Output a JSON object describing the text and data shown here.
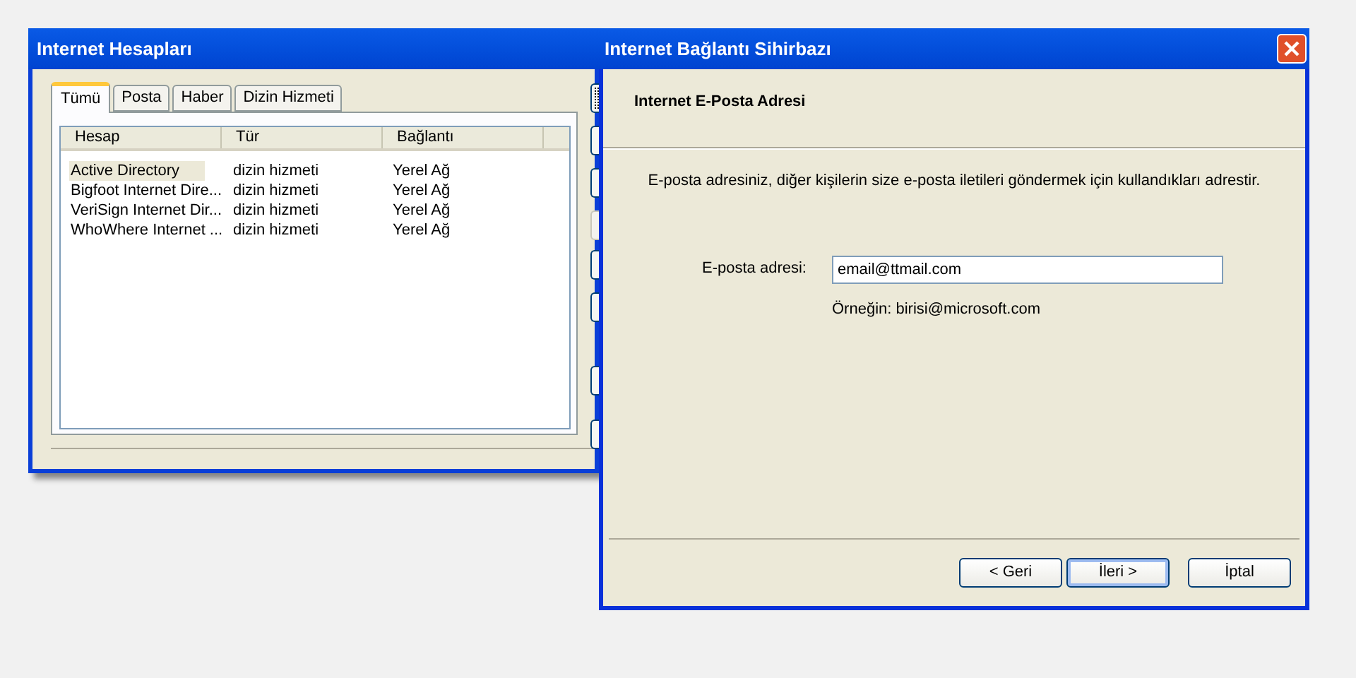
{
  "back_window": {
    "title": "Internet Hesapları",
    "tabs": [
      {
        "label": "Tümü",
        "selected": true
      },
      {
        "label": "Posta",
        "selected": false
      },
      {
        "label": "Haber",
        "selected": false
      },
      {
        "label": "Dizin Hizmeti",
        "selected": false
      }
    ],
    "columns": [
      "Hesap",
      "Tür",
      "Bağlantı"
    ],
    "rows": [
      {
        "cells": [
          "Active Directory",
          "dizin hizmeti",
          "Yerel Ağ"
        ],
        "selected": true
      },
      {
        "cells": [
          "Bigfoot Internet Dire...",
          "dizin hizmeti",
          "Yerel Ağ"
        ],
        "selected": false
      },
      {
        "cells": [
          "VeriSign Internet Dir...",
          "dizin hizmeti",
          "Yerel Ağ"
        ],
        "selected": false
      },
      {
        "cells": [
          "WhoWhere Internet ...",
          "dizin hizmeti",
          "Yerel Ağ"
        ],
        "selected": false
      }
    ],
    "side_buttons": [
      {
        "disabled": false,
        "focused": true
      },
      {
        "disabled": false,
        "focused": false
      },
      {
        "disabled": false,
        "focused": false
      },
      {
        "disabled": true,
        "focused": false
      },
      {
        "disabled": false,
        "focused": false
      },
      {
        "disabled": false,
        "focused": false
      },
      {
        "disabled": false,
        "focused": false
      },
      {
        "disabled": false,
        "focused": false
      }
    ]
  },
  "wizard": {
    "title": "Internet Bağlantı Sihirbazı",
    "heading": "Internet E-Posta Adresi",
    "description": "E-posta adresiniz, diğer kişilerin size e-posta iletileri göndermek için kullandıkları adrestir.",
    "field": {
      "label": "E-posta adresi:",
      "value": "email@ttmail.com"
    },
    "hint": "Örneğin: birisi@microsoft.com",
    "buttons": [
      {
        "label": "< Geri",
        "default": false
      },
      {
        "label": "İleri >",
        "default": true
      },
      {
        "label": "İptal",
        "default": false
      }
    ]
  }
}
